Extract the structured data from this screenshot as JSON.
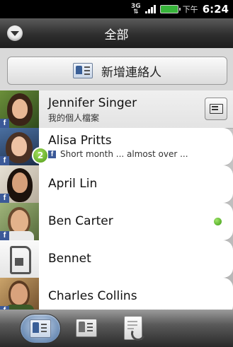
{
  "status_bar": {
    "network": "3G",
    "ampm": "下午",
    "time": "6:24"
  },
  "header": {
    "title": "全部"
  },
  "add_contact": {
    "label": "新增連絡人"
  },
  "contacts": [
    {
      "name": "Jennifer Singer",
      "subtitle": "我的個人檔案",
      "facebook": true
    },
    {
      "name": "Alisa Pritts",
      "status": "Short month ... almost over ...",
      "facebook": true,
      "badge": "2"
    },
    {
      "name": "April Lin",
      "facebook": true
    },
    {
      "name": "Ben Carter",
      "facebook": true,
      "online": true
    },
    {
      "name": "Bennet",
      "facebook": false
    },
    {
      "name": "Charles Collins",
      "facebook": true
    }
  ],
  "facebook_glyph": "f",
  "bottom_tabs": [
    {
      "icon": "contacts-card-icon",
      "active": true
    },
    {
      "icon": "groups-card-icon",
      "active": false
    },
    {
      "icon": "call-history-icon",
      "active": false
    }
  ],
  "colors": {
    "facebook": "#3b5998",
    "online": "#4caf1b",
    "badge": "#5aa820"
  }
}
